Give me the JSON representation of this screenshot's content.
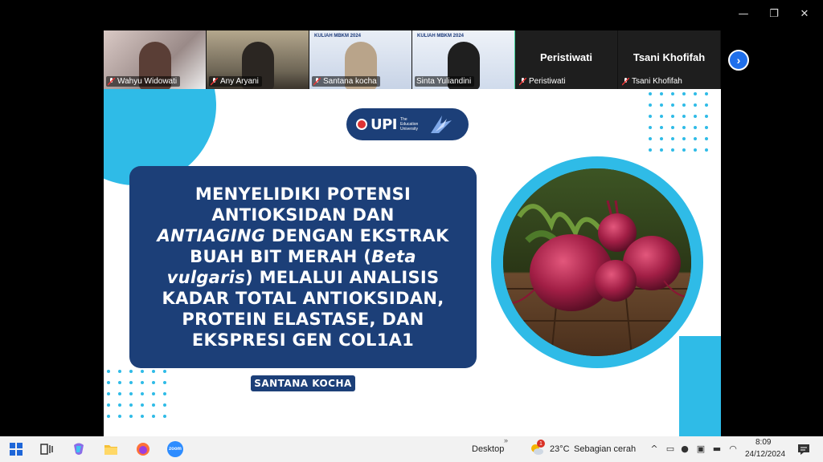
{
  "window": {
    "minimize": "—",
    "restore": "❐",
    "close": "✕"
  },
  "participants": [
    {
      "name": "Wahyu Widowati",
      "type": "video"
    },
    {
      "name": "Any Aryani",
      "type": "video"
    },
    {
      "name": "Santana kocha",
      "type": "video",
      "banner": "KULIAH MBKM 2024"
    },
    {
      "name": "Sinta Yuliandini",
      "type": "video",
      "banner": "KULIAH MBKM 2024",
      "active": true
    },
    {
      "name": "Peristiwati",
      "type": "avatar",
      "display_name": "Peristiwati"
    },
    {
      "name": "Tsani Khofifah",
      "type": "avatar",
      "display_name": "Tsani Khofifah"
    }
  ],
  "next_label": "›",
  "slide": {
    "logo_text": "UPI",
    "logo_sub": "The Education University",
    "title_lines": [
      "MENYELIDIKI POTENSI",
      "ANTIOKSIDAN DAN",
      "ANTIAGING DENGAN EKSTRAK",
      "BUAH BIT MERAH (Beta",
      "vulgaris) MELALUI ANALISIS",
      "KADAR TOTAL ANTIOKSIDAN,",
      "PROTEIN ELASTASE, DAN",
      "EKSPRESI GEN COL1A1"
    ],
    "author": "SANTANA KOCHA",
    "accent_color": "#2fbbe7",
    "primary_color": "#1c3f78"
  },
  "taskbar": {
    "desktop_label": "Desktop",
    "weather_temp": "23°C",
    "weather_desc": "Sebagian cerah",
    "weather_badge": "1",
    "time": "8:09",
    "date": "24/12/2024",
    "zoom_label": "zoom"
  }
}
